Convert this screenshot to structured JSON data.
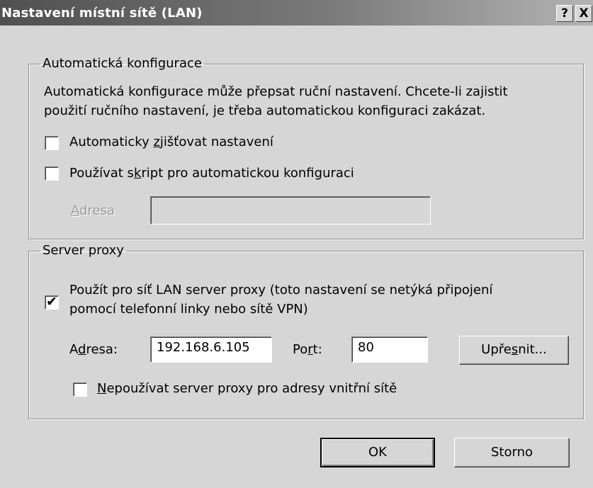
{
  "dialog": {
    "title": "Nastavení místní sítě (LAN)",
    "help_button": "?",
    "close_button": "X"
  },
  "auto_config": {
    "legend": "Automatická konfigurace",
    "description_line1": "Automatická konfigurace může přepsat ruční nastavení. Chcete-li zajistit",
    "description_line2": "použití ručního nastavení, je třeba automatickou konfiguraci zakázat.",
    "auto_detect": {
      "label_pre": "Automaticky ",
      "label_key": "z",
      "label_post": "jišťovat nastavení",
      "checked": false
    },
    "use_script": {
      "label_pre": "Používat s",
      "label_key": "k",
      "label_post": "ript pro automatickou konfiguraci",
      "checked": false
    },
    "address_label": {
      "key": "A",
      "rest": "dresa"
    },
    "address_value": ""
  },
  "proxy": {
    "legend": "Server proxy",
    "use_proxy": {
      "label_line1": "Použít pro síť LAN server proxy (toto nastavení se netýká připojení",
      "label_line2": "pomocí telefonní linky nebo sítě VPN)",
      "checked": true,
      "check_glyph": "✔"
    },
    "address_label": {
      "pre": "A",
      "key": "d",
      "post": "resa:"
    },
    "address_value": "192.168.6.105",
    "port_label": {
      "pre": "Po",
      "key": "r",
      "post": "t:"
    },
    "port_value": "80",
    "advanced_button": {
      "pre": "Upře",
      "key": "s",
      "post": "nit..."
    },
    "bypass_local": {
      "key": "N",
      "rest": "epoužívat server proxy pro adresy vnitřní sítě",
      "checked": false
    }
  },
  "buttons": {
    "ok": "OK",
    "cancel": "Storno"
  },
  "colors": {
    "dialog_bg": "#d6d6d6",
    "titlebar_start": "#505050",
    "titlebar_end": "#b4b4b4"
  }
}
